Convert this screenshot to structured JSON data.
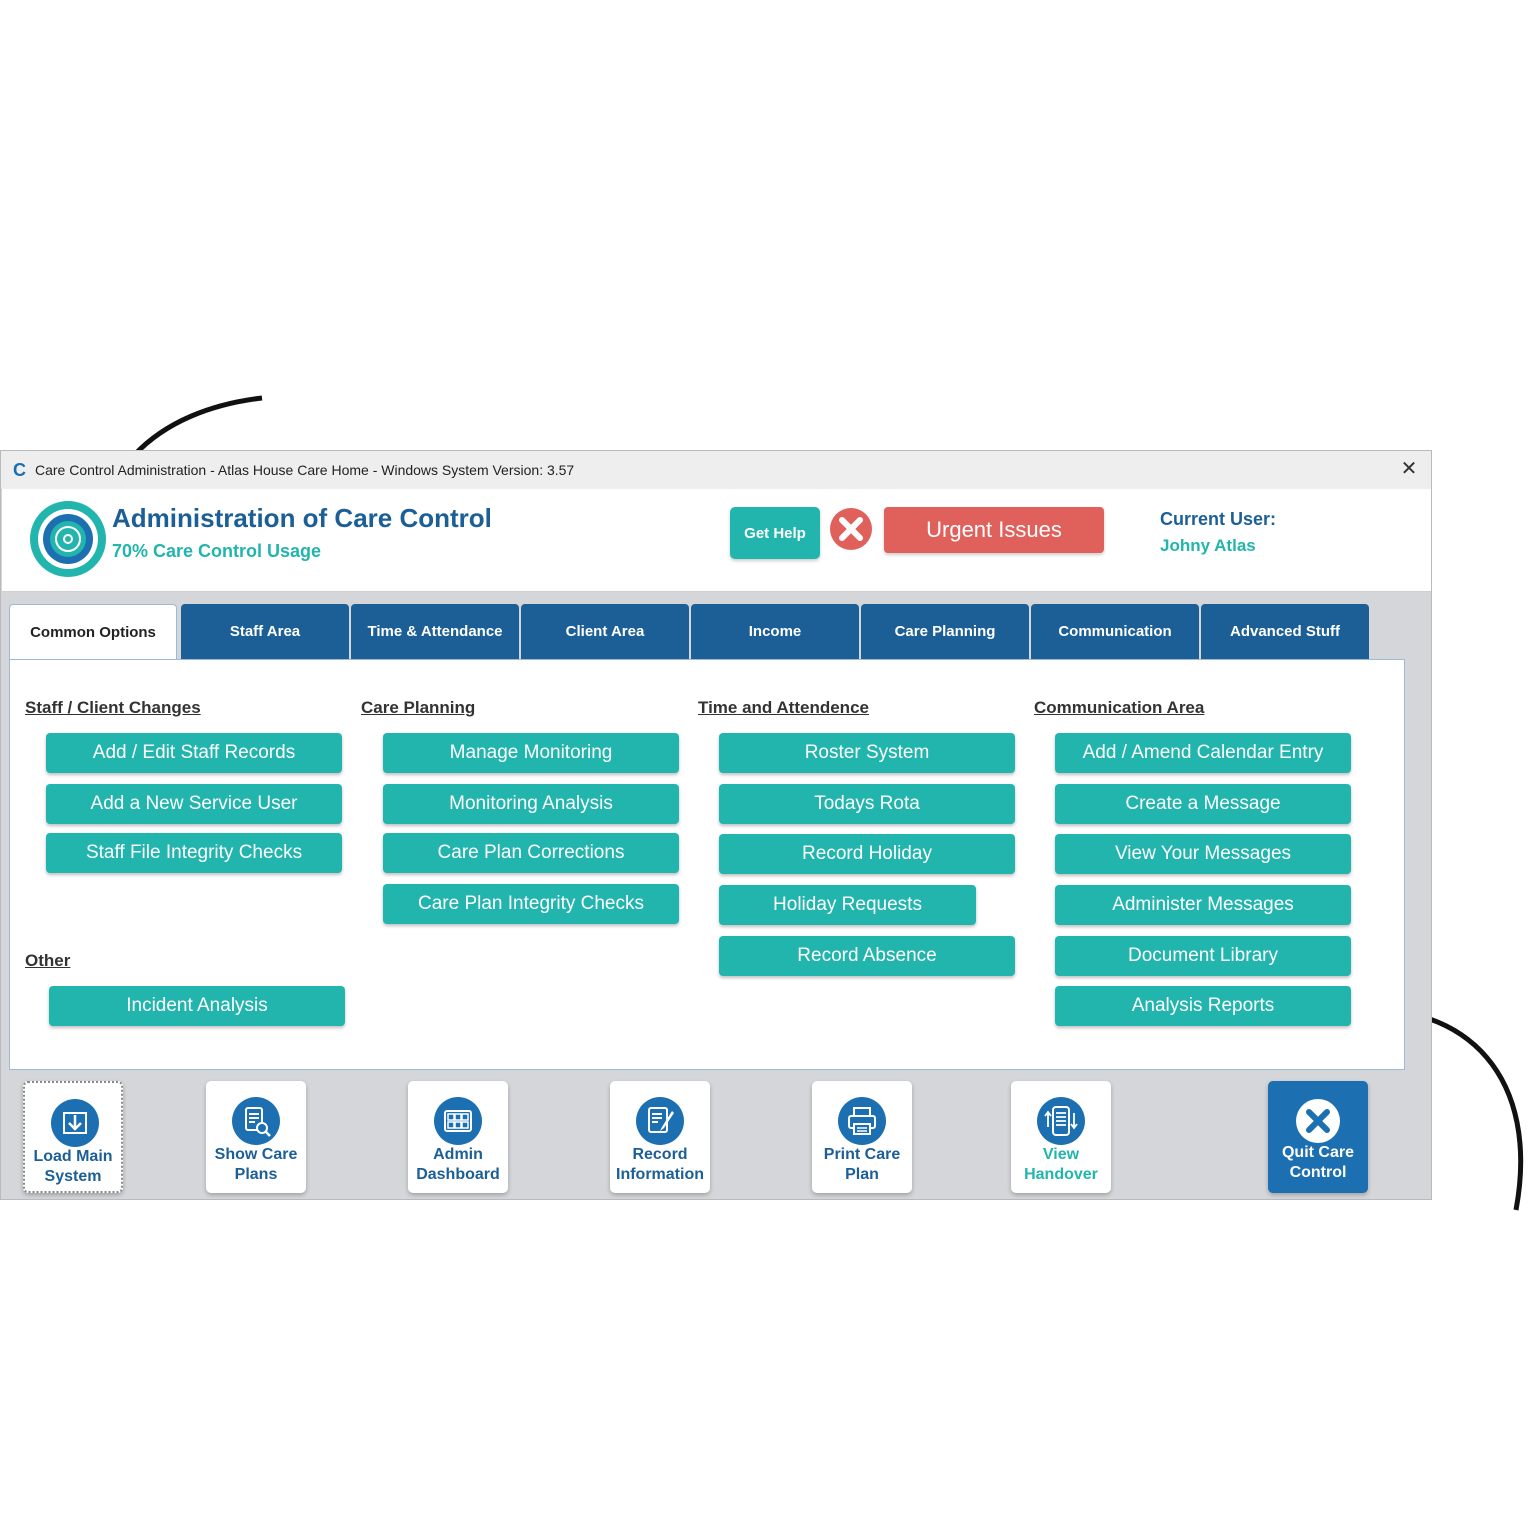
{
  "window": {
    "title": "Care Control Administration - Atlas House Care Home - Windows System Version: 3.57",
    "close_symbol": "✕"
  },
  "header": {
    "app_title": "Administration of Care Control",
    "usage": "70% Care Control Usage",
    "get_help": "Get Help",
    "urgent": "Urgent Issues",
    "current_user_label": "Current User:",
    "current_user_name": "Johny Atlas"
  },
  "tabs": [
    "Common Options",
    "Staff Area",
    "Time & Attendance",
    "Client Area",
    "Income",
    "Care Planning",
    "Communication",
    "Advanced Stuff"
  ],
  "sections": {
    "staff_client": {
      "title": "Staff / Client Changes",
      "buttons": [
        "Add / Edit Staff Records",
        "Add a New Service User",
        "Staff File Integrity Checks"
      ]
    },
    "other": {
      "title": "Other",
      "buttons": [
        "Incident Analysis"
      ]
    },
    "care_planning": {
      "title": "Care Planning",
      "buttons": [
        "Manage Monitoring",
        "Monitoring Analysis",
        "Care Plan Corrections",
        "Care Plan Integrity Checks"
      ]
    },
    "time": {
      "title": "Time and Attendence",
      "buttons": [
        "Roster System",
        "Todays Rota",
        "Record Holiday",
        "Holiday Requests",
        "Record Absence"
      ]
    },
    "communication": {
      "title": "Communication Area",
      "buttons": [
        "Add / Amend Calendar Entry",
        "Create a Message",
        "View Your Messages",
        "Administer Messages",
        "Document Library",
        "Analysis Reports"
      ]
    }
  },
  "bottom": [
    {
      "line1": "Load Main",
      "line2": "System",
      "icon": "download-icon"
    },
    {
      "line1": "Show Care",
      "line2": "Plans",
      "icon": "document-search-icon"
    },
    {
      "line1": "Admin",
      "line2": "Dashboard",
      "icon": "dashboard-icon"
    },
    {
      "line1": "Record",
      "line2": "Information",
      "icon": "edit-document-icon"
    },
    {
      "line1": "Print Care",
      "line2": "Plan",
      "icon": "printer-icon"
    },
    {
      "line1": "View",
      "line2": "Handover",
      "icon": "handover-icon"
    },
    {
      "line1": "Quit Care",
      "line2": "Control",
      "icon": "quit-icon"
    }
  ],
  "colors": {
    "primary_blue": "#1c5f96",
    "teal": "#22b5ad",
    "urgent_red": "#e0605c",
    "quit_blue": "#1c6fb0"
  }
}
